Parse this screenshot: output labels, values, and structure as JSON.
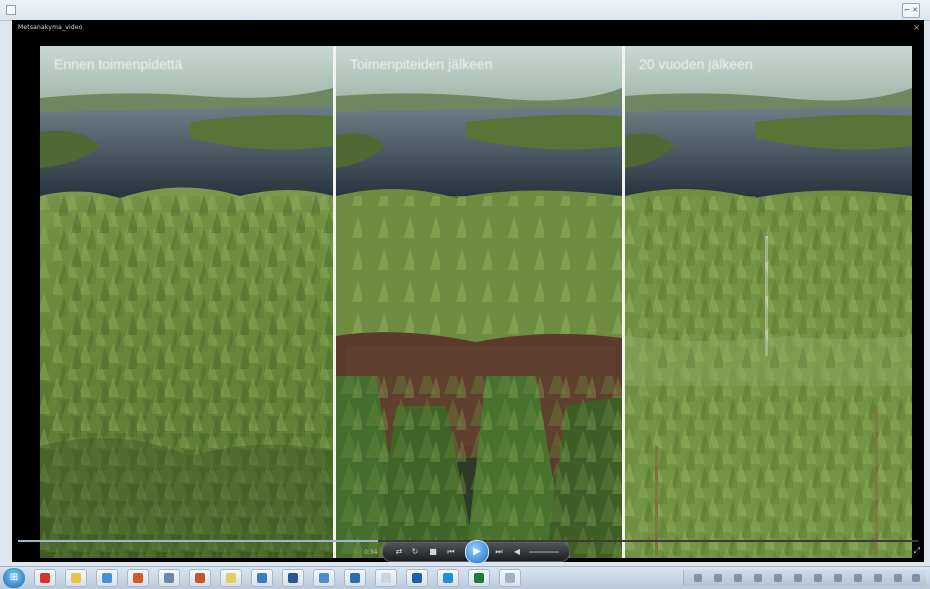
{
  "window": {
    "app_icon": "media-player-icon",
    "controls_icon": "window-controls-icon",
    "controls_text": "⌐ ✕"
  },
  "player": {
    "title": "Metsanakyma_video",
    "close": "×",
    "progress_fraction": 0.4,
    "time": "0:34",
    "fullscreen": "⤢"
  },
  "video": {
    "panels": [
      {
        "caption": "Ennen toimenpidettä"
      },
      {
        "caption": "Toimenpiteiden jälkeen"
      },
      {
        "caption": "20 vuoden jälkeen"
      }
    ]
  },
  "controls": {
    "shuffle": "⇄",
    "repeat": "↻",
    "stop": "■",
    "previous": "⏮",
    "play": "▶",
    "next": "⏭",
    "mute": "◀"
  },
  "taskbar": {
    "start_icon": "windows-start-icon",
    "apps": [
      {
        "name": "chrome-icon",
        "color": "#d9342b"
      },
      {
        "name": "folder-icon",
        "color": "#e8c24a"
      },
      {
        "name": "media-icon",
        "color": "#4b8fd6"
      },
      {
        "name": "office-icon",
        "color": "#d45a2a"
      },
      {
        "name": "tool-icon",
        "color": "#6a88a8"
      },
      {
        "name": "paint-icon",
        "color": "#c05a2a"
      },
      {
        "name": "notes-icon",
        "color": "#e0d060"
      },
      {
        "name": "globe-icon",
        "color": "#3a7cc0"
      },
      {
        "name": "word-icon",
        "color": "#2b5797"
      },
      {
        "name": "browser-icon",
        "color": "#4a8ed0"
      },
      {
        "name": "doc-icon",
        "color": "#2c6cb0"
      },
      {
        "name": "blank-icon",
        "color": "#c8d6e4"
      },
      {
        "name": "outlook-icon",
        "color": "#1f5ea8"
      },
      {
        "name": "skype-icon",
        "color": "#1f8fd6"
      },
      {
        "name": "excel-icon",
        "color": "#1f7a3a"
      },
      {
        "name": "settings-icon",
        "color": "#9fb0c2"
      }
    ]
  }
}
